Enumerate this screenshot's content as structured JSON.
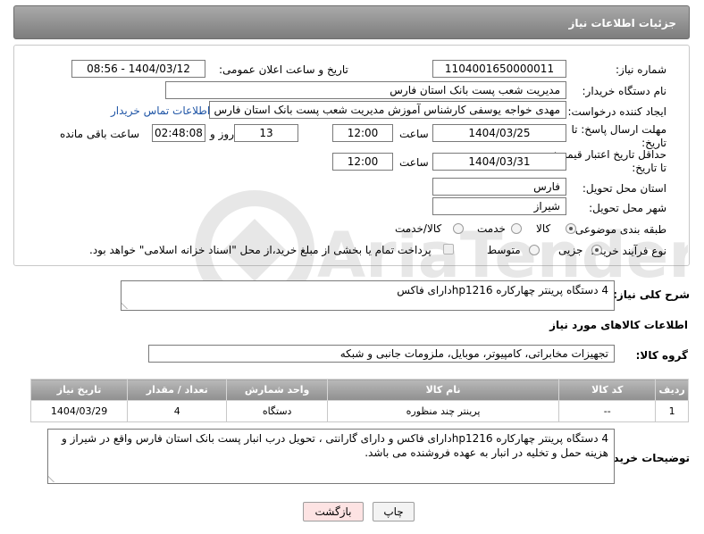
{
  "header": {
    "title": "جزئیات اطلاعات نیاز"
  },
  "form": {
    "need_number_label": "شماره نیاز:",
    "need_number": "1104001650000011",
    "announce_label": "تاریخ و ساعت اعلان عمومی:",
    "announce_value": "1404/03/12 - 08:56",
    "buyer_org_label": "نام دستگاه خریدار:",
    "buyer_org": "مدیریت شعب پست بانک استان فارس",
    "creator_label": "ایجاد کننده درخواست:",
    "creator": "مهدی خواجه یوسفی کارشناس آموزش مدیریت شعب پست بانک استان فارس",
    "contact_link": "اطلاعات تماس خریدار",
    "deadline_label_1": "مهلت ارسال پاسخ: تا",
    "deadline_label_2": "تاریخ:",
    "deadline_date": "1404/03/25",
    "time_label": "ساعت",
    "deadline_time": "12:00",
    "days_value": "13",
    "days_label": "روز و",
    "remaining_value": "02:48:08",
    "remaining_label": "ساعت باقی مانده",
    "validity_label_1": "حداقل تاریخ اعتبار قیمت:",
    "validity_label_2": "تا تاریخ:",
    "validity_date": "1404/03/31",
    "validity_time": "12:00",
    "province_label": "استان محل تحویل:",
    "province": "فارس",
    "city_label": "شهر محل تحویل:",
    "city": "شیراز",
    "category_label": "طبقه بندی موضوعی:",
    "category_options": [
      "کالا",
      "خدمت",
      "کالا/خدمت"
    ],
    "process_label": "نوع فرآیند خرید :",
    "process_options": [
      "جزیی",
      "متوسط"
    ],
    "payment_note": "پرداخت تمام یا بخشی از مبلغ خرید،از محل \"اسناد خزانه اسلامی\" خواهد بود."
  },
  "general_desc": {
    "label": "شرح کلی نیاز:",
    "text": "4 دستگاه پرینتر چهارکاره hp1216دارای فاکس"
  },
  "goods": {
    "section_title": "اطلاعات کالاهای مورد نیاز",
    "group_label": "گروه کالا:",
    "group_value": "تجهیزات مخابراتی، کامپیوتر، موبایل، ملزومات جانبی و شبکه",
    "columns": [
      "ردیف",
      "کد کالا",
      "نام کالا",
      "واحد شمارش",
      "تعداد / مقدار",
      "تاریخ نیاز"
    ],
    "rows": [
      {
        "row": "1",
        "code": "--",
        "name": "پرینتر چند منظوره",
        "unit": "دستگاه",
        "qty": "4",
        "date": "1404/03/29"
      }
    ]
  },
  "buyer_notes": {
    "label": "توضیحات خریدار:",
    "text": "4 دستگاه پرینتر چهارکاره hp1216دارای فاکس  و دارای گارانتی ، تحویل درب انبار پست بانک استان فارس واقع در شیراز و هزینه حمل و تخلیه در انبار به عهده فروشنده می باشد."
  },
  "buttons": {
    "print": "چاپ",
    "back": "بازگشت"
  },
  "watermark": {
    "text": "AriaTender.net"
  },
  "colors": {
    "header": "#8a8a8a",
    "link": "#1f55a6",
    "back_button": "#fde3e3"
  }
}
